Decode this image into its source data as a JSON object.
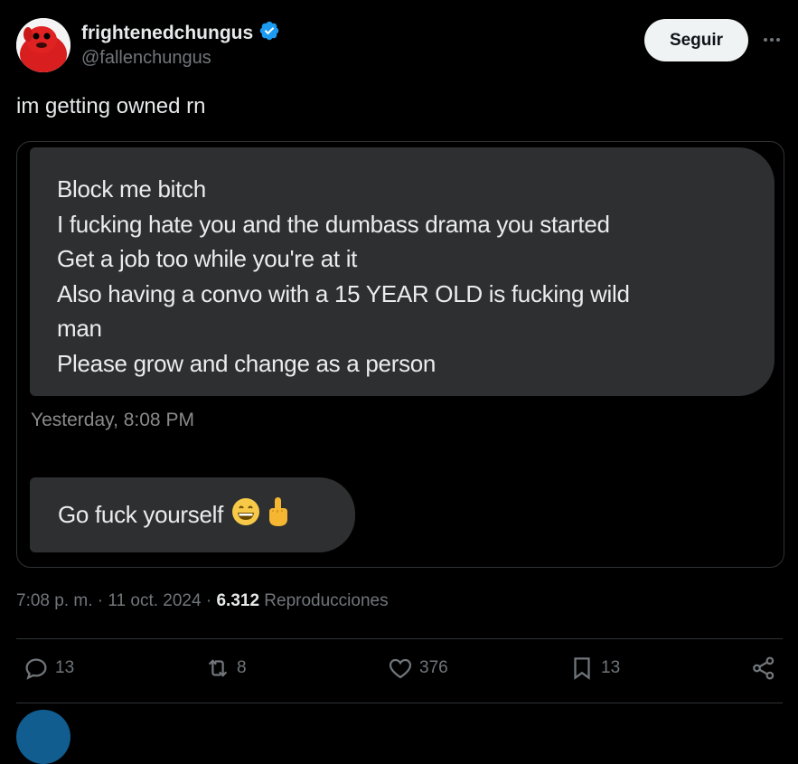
{
  "author": {
    "display_name": "frightenedchungus",
    "handle": "@fallenchungus",
    "verified": true
  },
  "follow_label": "Seguir",
  "tweet_text": "im getting owned rn",
  "media": {
    "message_lines": [
      "Block me bitch",
      "I fucking hate you and the dumbass drama you started",
      "Get a job too while you're at it",
      "Also having a convo with a 15 YEAR OLD is fucking wild",
      "man",
      "Please grow and change as a person"
    ],
    "chat_timestamp": "Yesterday, 8:08 PM",
    "reply_text": "Go fuck yourself",
    "reply_emojis": [
      "grinning-face-icon",
      "middle-finger-icon"
    ]
  },
  "meta": {
    "time": "7:08 p. m.",
    "separator": "·",
    "date": "11 oct. 2024",
    "views_count": "6.312",
    "views_label": "Reproducciones"
  },
  "actions": {
    "replies": "13",
    "reposts": "8",
    "likes": "376",
    "bookmarks": "13"
  },
  "colors": {
    "background": "#000000",
    "text": "#e7e9ea",
    "muted": "#71767b",
    "verified": "#1d9bf0",
    "bubble": "#2e2f31"
  }
}
